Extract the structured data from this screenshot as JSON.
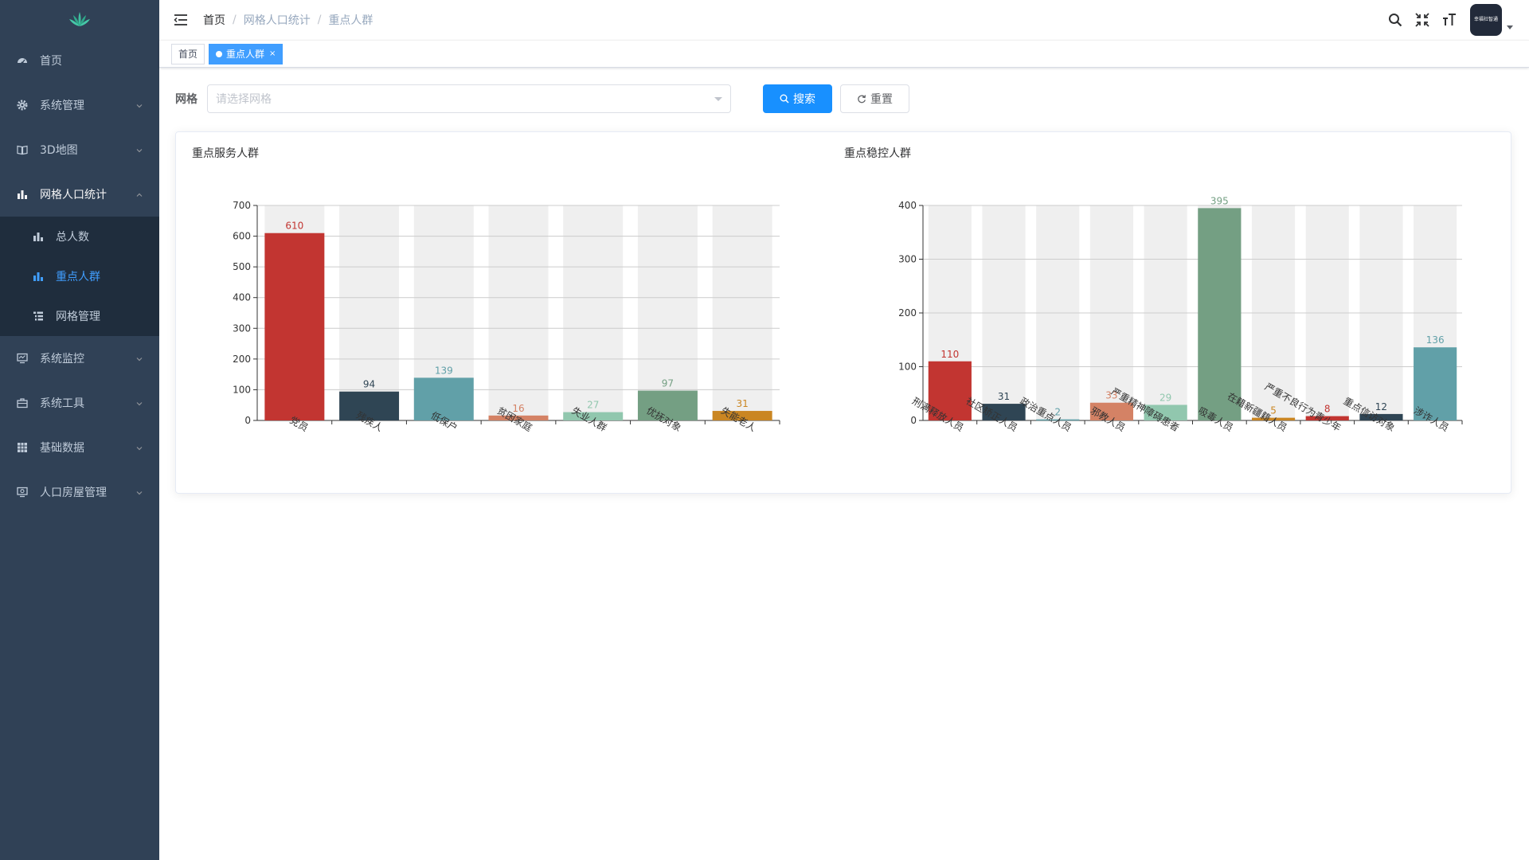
{
  "sidebar": {
    "items": [
      {
        "label": "首页",
        "icon": "dashboard-icon"
      },
      {
        "label": "系统管理",
        "icon": "gear-icon"
      },
      {
        "label": "3D地图",
        "icon": "book-icon"
      },
      {
        "label": "网格人口统计",
        "icon": "bar-chart-icon"
      },
      {
        "label": "系统监控",
        "icon": "monitor-icon"
      },
      {
        "label": "系统工具",
        "icon": "toolbox-icon"
      },
      {
        "label": "基础数据",
        "icon": "grid-icon"
      },
      {
        "label": "人口房屋管理",
        "icon": "monitor-icon"
      }
    ],
    "submenu": [
      {
        "label": "总人数"
      },
      {
        "label": "重点人群"
      },
      {
        "label": "网格管理"
      }
    ]
  },
  "navbar": {
    "breadcrumb": [
      "首页",
      "网格人口统计",
      "重点人群"
    ],
    "avatar_text": "幸福社智通"
  },
  "tags": {
    "home": "首页",
    "active": "重点人群",
    "close": "×"
  },
  "filter": {
    "label": "网格",
    "placeholder": "请选择网格",
    "search_label": "搜索",
    "reset_label": "重置"
  },
  "colors": {
    "sidebar_bg": "#304156",
    "submenu_bg": "#1f2d3d",
    "accent": "#409eff",
    "primary_button": "#1890ff"
  },
  "chart_data": [
    {
      "type": "bar",
      "title": "重点服务人群",
      "categories": [
        "党员",
        "残疾人",
        "低保户",
        "贫困家庭",
        "失业人群",
        "优抚对象",
        "失能老人"
      ],
      "values": [
        610,
        94,
        139,
        16,
        27,
        97,
        31
      ],
      "colors": [
        "#c23531",
        "#2f4554",
        "#61a0a8",
        "#d48265",
        "#91c7ae",
        "#749f83",
        "#ca8622"
      ],
      "ylim": [
        0,
        700
      ],
      "yticks": [
        0,
        100,
        200,
        300,
        400,
        500,
        600,
        700
      ],
      "background_bars": true,
      "grid": true
    },
    {
      "type": "bar",
      "title": "重点稳控人群",
      "categories": [
        "刑满释放人员",
        "社区矫正人员",
        "政治重点人员",
        "邪教人员",
        "严重精神障碍患者",
        "吸毒人员",
        "在籍新疆籍人员",
        "严重不良行为青少年",
        "重点信访对象",
        "涉诈人员"
      ],
      "values": [
        110,
        31,
        2,
        33,
        29,
        395,
        5,
        8,
        12,
        136
      ],
      "colors": [
        "#c23531",
        "#2f4554",
        "#61a0a8",
        "#d48265",
        "#91c7ae",
        "#749f83",
        "#ca8622",
        "#c23531",
        "#2f4554",
        "#61a0a8"
      ],
      "ylim": [
        0,
        400
      ],
      "yticks": [
        0,
        100,
        200,
        300,
        400
      ],
      "background_bars": true,
      "grid": true
    }
  ]
}
